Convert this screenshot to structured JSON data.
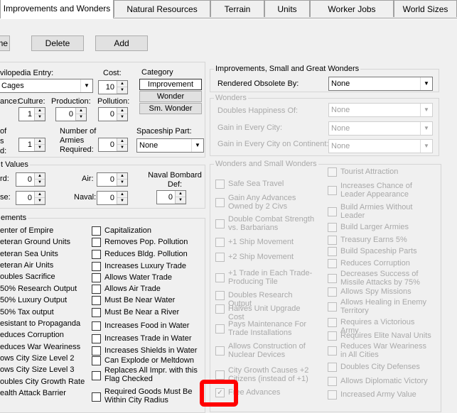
{
  "tabs": [
    "Improvements and Wonders",
    "Natural Resources",
    "Terrain",
    "Units",
    "Worker Jobs",
    "World Sizes"
  ],
  "buttons": {
    "rename": "me",
    "delete": "Delete",
    "add": "Add"
  },
  "top": {
    "civilopedia_label": "vilopedia Entry:",
    "civilopedia_value": "Cages",
    "cost_label": "Cost:",
    "cost_value": "10",
    "ance_label": "ance:",
    "ance_value": "",
    "culture_label": "Culture:",
    "culture_value": "1",
    "production_label": "Production:",
    "production_value": "0",
    "pollution_label": "Pollution:",
    "pollution_value": "0",
    "of_label": "of",
    "s_label": "s",
    "d_label": "d:",
    "num_value": "1",
    "armies_label": "Number of Armies Required:",
    "armies_value": "0",
    "spaceship_label": "Spaceship Part:",
    "spaceship_value": "None"
  },
  "category": {
    "title": "Category",
    "items": [
      "Improvement",
      "Wonder",
      "Sm. Wonder"
    ]
  },
  "obsolete": {
    "title": "Improvements, Small and Great Wonders",
    "label": "Rendered Obsolete By:",
    "value": "None"
  },
  "wonders": {
    "title": "Wonders",
    "rows": [
      {
        "label": "Doubles Happiness Of:",
        "value": "None"
      },
      {
        "label": "Gain in Every City:",
        "value": "None"
      },
      {
        "label": "Gain in Every City on Continent:",
        "value": "None"
      }
    ]
  },
  "values": {
    "title": "t Values",
    "rd_label": "rd:",
    "rd_value": "0",
    "air_label": "Air:",
    "air_value": "0",
    "naval_bombard_label": "Naval Bombard Def:",
    "naval_bombard_value": "0",
    "se_label": "se:",
    "se_value": "0",
    "naval_label": "Naval:",
    "naval_value": "0"
  },
  "flags_title": "ements",
  "flags_col1": [
    "enter of Empire",
    "eteran Ground Units",
    "eteran Sea Units",
    "eteran Air Units",
    "oubles Sacrifice",
    "50% Research Output",
    "50% Luxury Output",
    "50% Tax output",
    "esistant to Propaganda",
    "educes Corruption",
    "educes War Weariness",
    "ows City Size Level 2",
    "ows City Size Level 3",
    "oubles City Growth Rate",
    "ealth Attack Barrier"
  ],
  "flags_col2": [
    "Capitalization",
    "Removes Pop. Pollution",
    "Reduces Bldg. Pollution",
    "Increases Luxury Trade",
    "Allows Water Trade",
    "Allows Air Trade",
    "Must Be Near Water",
    "Must Be Near a River",
    "Increases Food in Water",
    "Increases Trade in Water",
    "Increases Shields in Water",
    "Can Explode or Meltdown",
    "Replaces All Impr. with this Flag Checked",
    "Required Goods Must Be Within City Radius"
  ],
  "small_wonders": {
    "title": "Wonders and Small Wonders",
    "left": [
      "Safe Sea Travel",
      "Gain Any Advances Owned by 2 Civs",
      "Double Combat Strength vs. Barbarians",
      "+1 Ship Movement",
      "+2 Ship Movement",
      "+1 Trade in Each Trade-Producing Tile",
      "Doubles Research Output",
      "Halves Unit Upgrade Cost",
      "Pays Maintenance For Trade Installations",
      "Allows Construction of Nuclear Devices",
      "City Growth Causes +2 Citizens (instead of +1)",
      "Free Advances"
    ],
    "right": [
      "Tourist Attraction",
      "Increases Chance of Leader Appearance",
      "Build Armies Without Leader",
      "Build Larger Armies",
      "Treasury Earns 5%",
      "Build Spaceship Parts",
      "Reduces Corruption",
      "Decreases Success of Missile Attacks by 75%",
      "Allows Spy Missions",
      "Allows Healing in Enemy Territory",
      "Requires a Victorious Army",
      "Requires Elite Naval Units",
      "Reduces War Weariness in All Cities",
      "Doubles City Defenses",
      "Allows Diplomatic Victory",
      "Increased Army Value"
    ]
  },
  "highlight_color": "#ff0000"
}
